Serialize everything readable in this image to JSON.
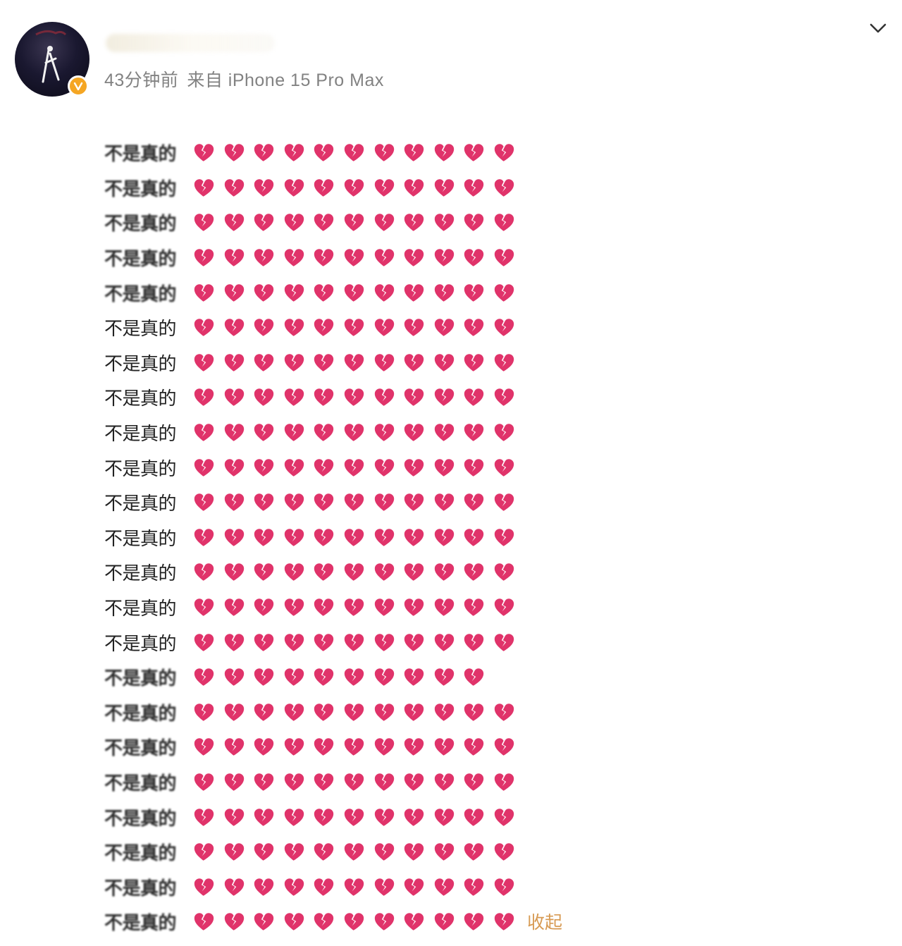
{
  "post": {
    "header": {
      "timestamp": "43分钟前",
      "source": "来自 iPhone 15 Pro Max",
      "verified_badge_color": "#f5a623",
      "menu_icon": "chevron-down-icon"
    },
    "heart_icon": "broken-heart-icon",
    "heart_color": "#e0336a",
    "lines": [
      {
        "text": "不是真的",
        "hearts": 11,
        "blurred": true
      },
      {
        "text": "不是真的",
        "hearts": 11,
        "blurred": true
      },
      {
        "text": "不是真的",
        "hearts": 11,
        "blurred": true
      },
      {
        "text": "不是真的",
        "hearts": 11,
        "blurred": true
      },
      {
        "text": "不是真的",
        "hearts": 11,
        "blurred": true
      },
      {
        "text": "不是真的",
        "hearts": 11,
        "blurred": false
      },
      {
        "text": "不是真的",
        "hearts": 11,
        "blurred": false
      },
      {
        "text": "不是真的",
        "hearts": 11,
        "blurred": false
      },
      {
        "text": "不是真的",
        "hearts": 11,
        "blurred": false
      },
      {
        "text": "不是真的",
        "hearts": 11,
        "blurred": false
      },
      {
        "text": "不是真的",
        "hearts": 11,
        "blurred": false
      },
      {
        "text": "不是真的",
        "hearts": 11,
        "blurred": false
      },
      {
        "text": "不是真的",
        "hearts": 11,
        "blurred": false
      },
      {
        "text": "不是真的",
        "hearts": 11,
        "blurred": false
      },
      {
        "text": "不是真的",
        "hearts": 11,
        "blurred": false
      },
      {
        "text": "不是真的",
        "hearts": 10,
        "blurred": true
      },
      {
        "text": "不是真的",
        "hearts": 11,
        "blurred": true
      },
      {
        "text": "不是真的",
        "hearts": 11,
        "blurred": true
      },
      {
        "text": "不是真的",
        "hearts": 11,
        "blurred": true
      },
      {
        "text": "不是真的",
        "hearts": 11,
        "blurred": true
      },
      {
        "text": "不是真的",
        "hearts": 11,
        "blurred": true
      },
      {
        "text": "不是真的",
        "hearts": 11,
        "blurred": true
      },
      {
        "text": "不是真的",
        "hearts": 11,
        "blurred": true
      }
    ],
    "collapse_label": "收起"
  }
}
